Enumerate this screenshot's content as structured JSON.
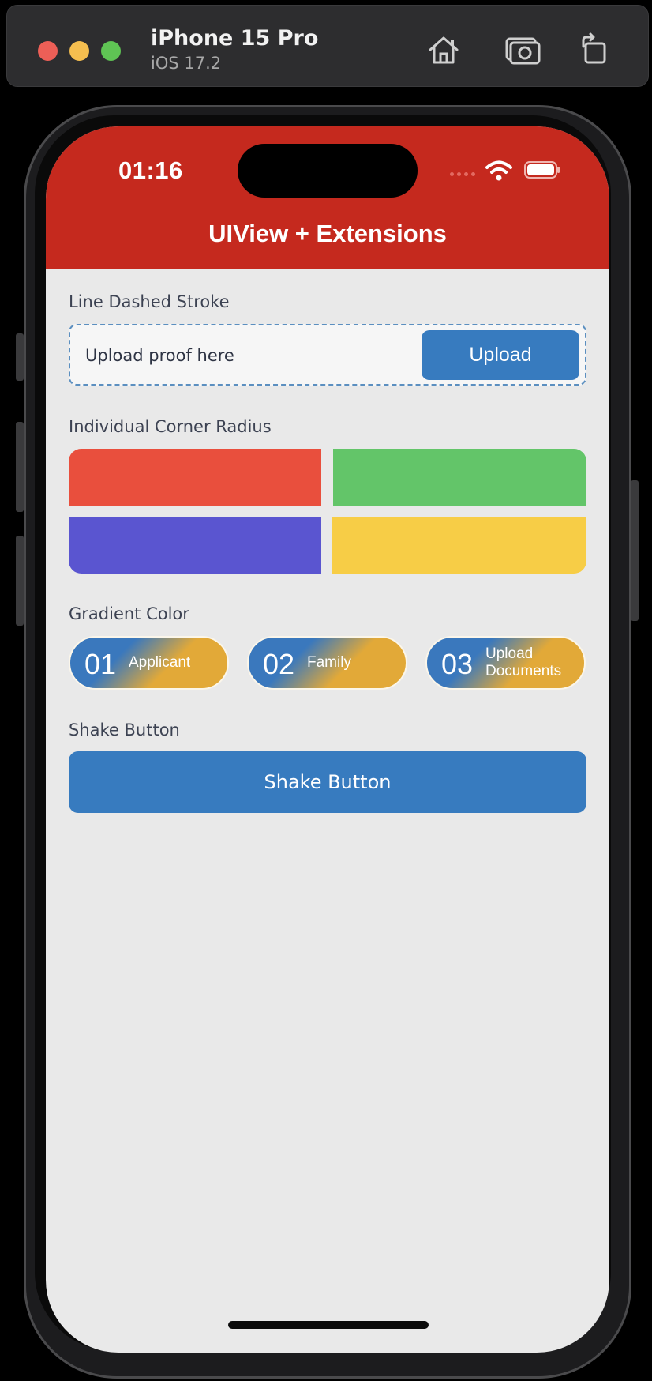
{
  "simulator": {
    "device_name": "iPhone 15 Pro",
    "os_version": "iOS 17.2",
    "buttons": [
      "home-icon",
      "screenshot-icon",
      "rotate-icon"
    ]
  },
  "status_bar": {
    "time": "01:16"
  },
  "nav": {
    "title": "UIView + Extensions",
    "color": "#c5291e"
  },
  "sections": {
    "dashed": {
      "label": "Line Dashed Stroke",
      "placeholder": "Upload proof here",
      "button_label": "Upload"
    },
    "corner": {
      "label": "Individual Corner Radius",
      "tiles": [
        "#e94f3d",
        "#63c569",
        "#5a55d0",
        "#f7cd46"
      ]
    },
    "gradient": {
      "label": "Gradient Color",
      "pills": [
        {
          "number": "01",
          "text": "Applicant"
        },
        {
          "number": "02",
          "text": "Family"
        },
        {
          "number": "03",
          "text": "Upload Documents"
        }
      ]
    },
    "shake": {
      "label": "Shake Button",
      "button_label": "Shake Button"
    }
  },
  "colors": {
    "accent_blue": "#377bbf",
    "gradient_start": "#3a78bd",
    "gradient_end": "#e2a938"
  }
}
